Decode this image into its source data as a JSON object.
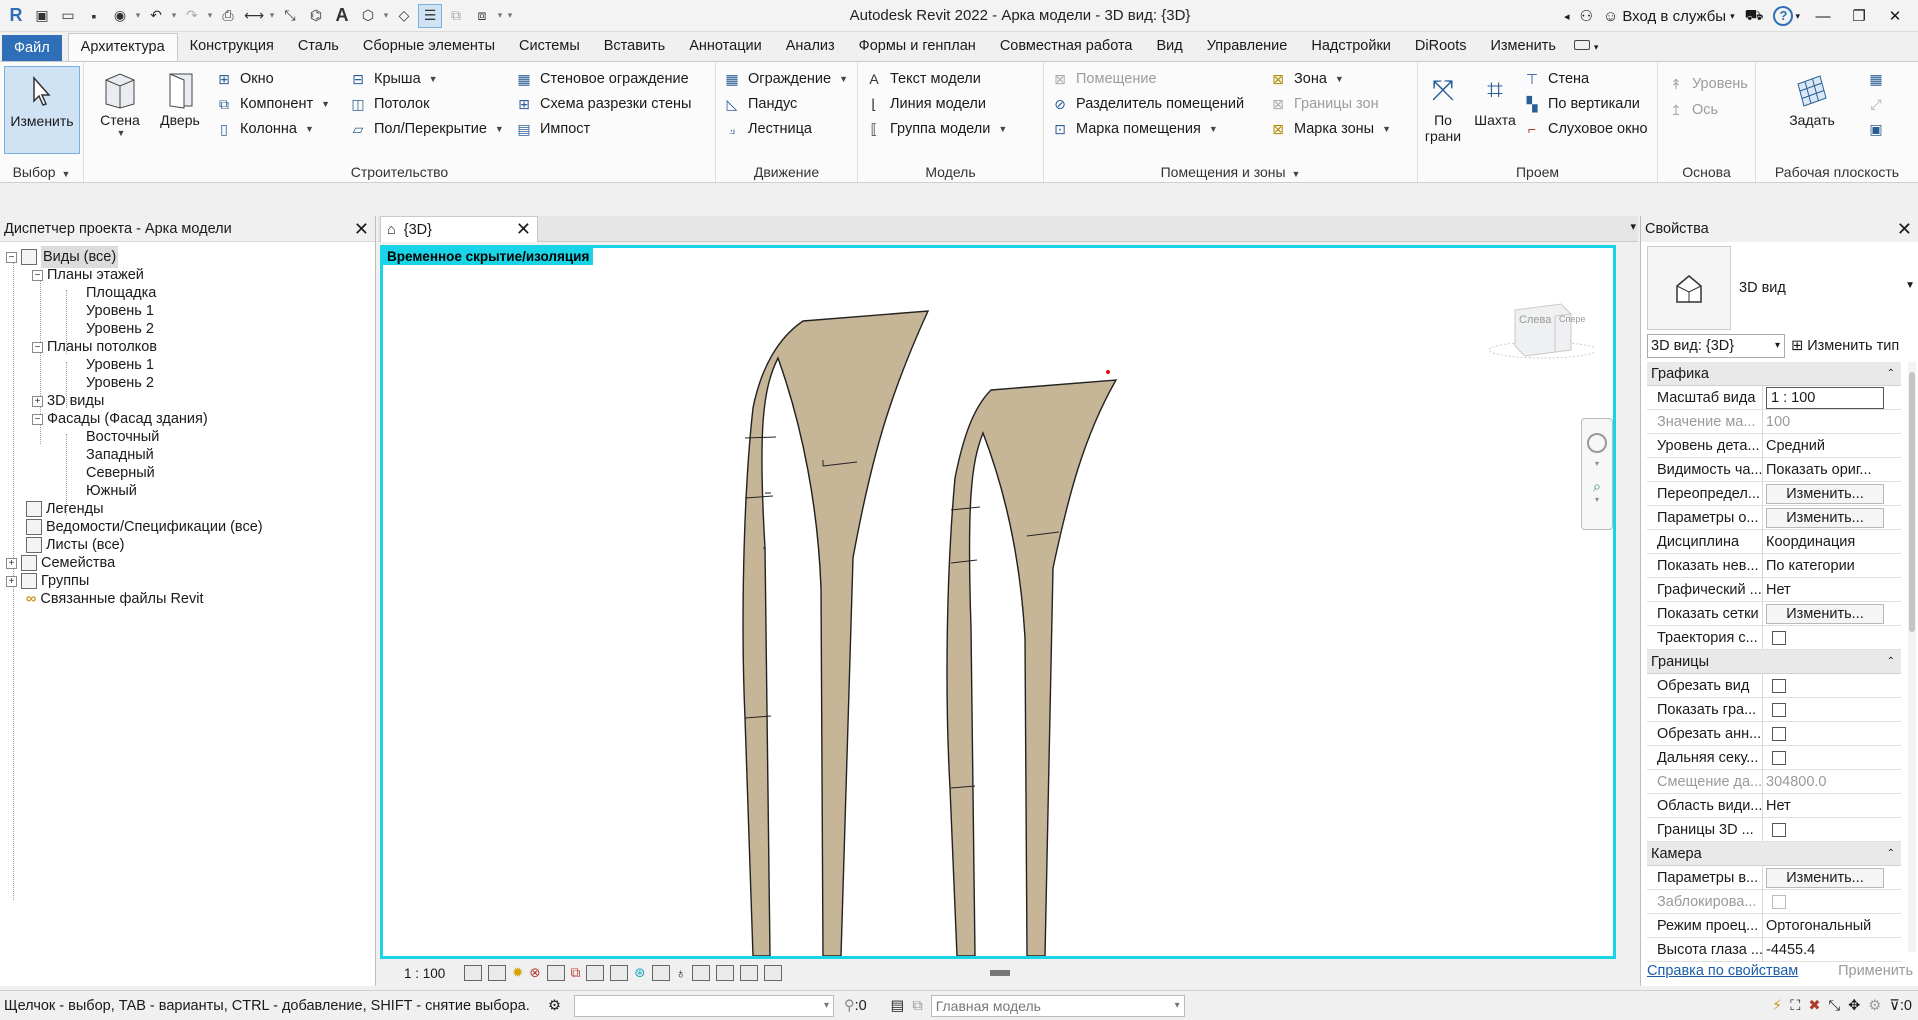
{
  "window": {
    "title": "Autodesk Revit 2022 - Арка модели - 3D вид: {3D}",
    "signin": "Вход в службы",
    "help": "?"
  },
  "tabs": [
    {
      "label": "Файл"
    },
    {
      "label": "Архитектура"
    },
    {
      "label": "Конструкция"
    },
    {
      "label": "Сталь"
    },
    {
      "label": "Сборные элементы"
    },
    {
      "label": "Системы"
    },
    {
      "label": "Вставить"
    },
    {
      "label": "Аннотации"
    },
    {
      "label": "Анализ"
    },
    {
      "label": "Формы и генплан"
    },
    {
      "label": "Совместная работа"
    },
    {
      "label": "Вид"
    },
    {
      "label": "Управление"
    },
    {
      "label": "Надстройки"
    },
    {
      "label": "DiRoots"
    },
    {
      "label": "Изменить"
    }
  ],
  "ribbon": {
    "select": {
      "modify": "Изменить",
      "label": "Выбор"
    },
    "build": {
      "label": "Строительство",
      "wall": "Стена",
      "door": "Дверь",
      "window": "Окно",
      "component": "Компонент",
      "column": "Колонна",
      "roof": "Крыша",
      "ceiling": "Потолок",
      "floor": "Пол/Перекрытие",
      "curtain_system": "Стеновое ограждение",
      "curtain_grid": "Схема разрезки стены",
      "mullion": "Импост"
    },
    "circulation": {
      "label": "Движение",
      "railing": "Ограждение",
      "ramp": "Пандус",
      "stair": "Лестница"
    },
    "model": {
      "label": "Модель",
      "text": "Текст модели",
      "line": "Линия  модели",
      "group": "Группа модели"
    },
    "rooms": {
      "label": "Помещения и зоны",
      "room": "Помещение",
      "separator": "Разделитель помещений",
      "tag": "Марка помещения",
      "area": "Зона",
      "area_boundary": "Границы  зон",
      "area_tag": "Марка  зоны"
    },
    "opening": {
      "label": "Проем",
      "by_face": "По",
      "by_face2": "грани",
      "shaft": "Шахта",
      "wall": "Стена",
      "vertical": "По вертикали",
      "dormer": "Слуховое окно"
    },
    "datum": {
      "label": "Основа",
      "level": "Уровень",
      "grid": "Ось"
    },
    "workplane": {
      "label": "Рабочая плоскость",
      "set": "Задать"
    }
  },
  "browser": {
    "title": "Диспетчер проекта - Арка модели",
    "items": [
      {
        "label": "Виды (все)"
      },
      {
        "label": "Планы этажей"
      },
      {
        "label": "Площадка"
      },
      {
        "label": "Уровень 1"
      },
      {
        "label": "Уровень 2"
      },
      {
        "label": "Планы потолков"
      },
      {
        "label": "Уровень 1"
      },
      {
        "label": "Уровень 2"
      },
      {
        "label": "3D виды"
      },
      {
        "label": "Фасады (Фасад здания)"
      },
      {
        "label": "Восточный"
      },
      {
        "label": "Западный"
      },
      {
        "label": "Северный"
      },
      {
        "label": "Южный"
      },
      {
        "label": "Легенды"
      },
      {
        "label": "Ведомости/Спецификации (все)"
      },
      {
        "label": "Листы (все)"
      },
      {
        "label": "Семейства"
      },
      {
        "label": "Группы"
      },
      {
        "label": "Связанные файлы Revit"
      }
    ]
  },
  "view": {
    "tab": "{3D}",
    "isolation": "Временное скрытие/изоляция",
    "scale": "1 : 100",
    "cube_left": "Слева",
    "cube_front": "Спере"
  },
  "properties": {
    "title": "Свойства",
    "type_name": "3D вид",
    "view_select": "3D вид: {3D}",
    "edit_type": "Изменить тип",
    "groups": {
      "graphics": "Графика",
      "extents": "Границы",
      "camera": "Камера"
    },
    "graphics": [
      {
        "k": "Масштаб вида",
        "v": "1 : 100"
      },
      {
        "k": "Значение ма...",
        "v": "100"
      },
      {
        "k": "Уровень дета...",
        "v": "Средний"
      },
      {
        "k": "Видимость ча...",
        "v": "Показать ориг..."
      },
      {
        "k": "Переопредел...",
        "v": "Изменить..."
      },
      {
        "k": "Параметры о...",
        "v": "Изменить..."
      },
      {
        "k": "Дисциплина",
        "v": "Координация"
      },
      {
        "k": "Показать нев...",
        "v": "По категории"
      },
      {
        "k": "Графический ...",
        "v": "Нет"
      },
      {
        "k": "Показать сетки",
        "v": "Изменить..."
      },
      {
        "k": "Траектория с...",
        "v": ""
      }
    ],
    "extents": [
      {
        "k": "Обрезать вид",
        "v": ""
      },
      {
        "k": "Показать гра...",
        "v": ""
      },
      {
        "k": "Обрезать анн...",
        "v": ""
      },
      {
        "k": "Дальняя секу...",
        "v": ""
      },
      {
        "k": "Смещение да...",
        "v": "304800.0"
      },
      {
        "k": "Область види...",
        "v": "Нет"
      },
      {
        "k": "Границы 3D ...",
        "v": ""
      }
    ],
    "camera": [
      {
        "k": "Параметры в...",
        "v": "Изменить..."
      },
      {
        "k": "Заблокирова...",
        "v": ""
      },
      {
        "k": "Режим проец...",
        "v": "Ортогональный"
      },
      {
        "k": "Высота глаза ...",
        "v": "-4455.4"
      }
    ],
    "help_link": "Справка по свойствам",
    "apply": "Применить"
  },
  "status": {
    "message": "Щелчок - выбор, TAB - варианты, CTRL - добавление, SHIFT - снятие выбора.",
    "worksets": ":0",
    "main_model": "Главная модель",
    "filter": ":0"
  },
  "colors": {
    "accent": "#2f6fb7",
    "isolation": "#19d3e6",
    "arch_fill": "#c7b597"
  }
}
